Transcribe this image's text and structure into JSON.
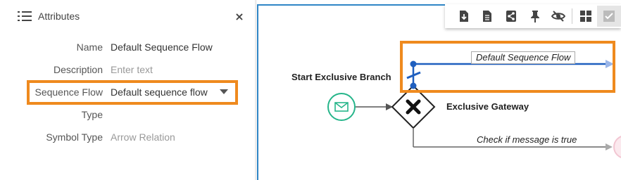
{
  "panel": {
    "title": "Attributes",
    "close_symbol": "×",
    "rows": [
      {
        "label": "Name",
        "value": "Default Sequence Flow"
      },
      {
        "label": "Description",
        "placeholder": "Enter text"
      },
      {
        "label": "Sequence Flow",
        "value": "Default sequence flow"
      },
      {
        "label": "Type",
        "value": ""
      },
      {
        "label": "Symbol Type",
        "value": "Arrow Relation"
      }
    ]
  },
  "toolbar": {
    "buttons": [
      "download-icon",
      "document-icon",
      "share-icon",
      "pin-icon",
      "hide-icon",
      "grid-icon",
      "check-icon"
    ]
  },
  "diagram": {
    "start_label": "Start Exclusive Branch",
    "gateway_label": "Exclusive Gateway",
    "default_flow_label": "Default Sequence Flow",
    "conditional_flow_label": "Check if message is true"
  },
  "colors": {
    "highlight": "#ef8a1e",
    "selection_blue": "#2f86c6",
    "start_event": "#26b58a",
    "default_flow": "#1f5fbf"
  }
}
